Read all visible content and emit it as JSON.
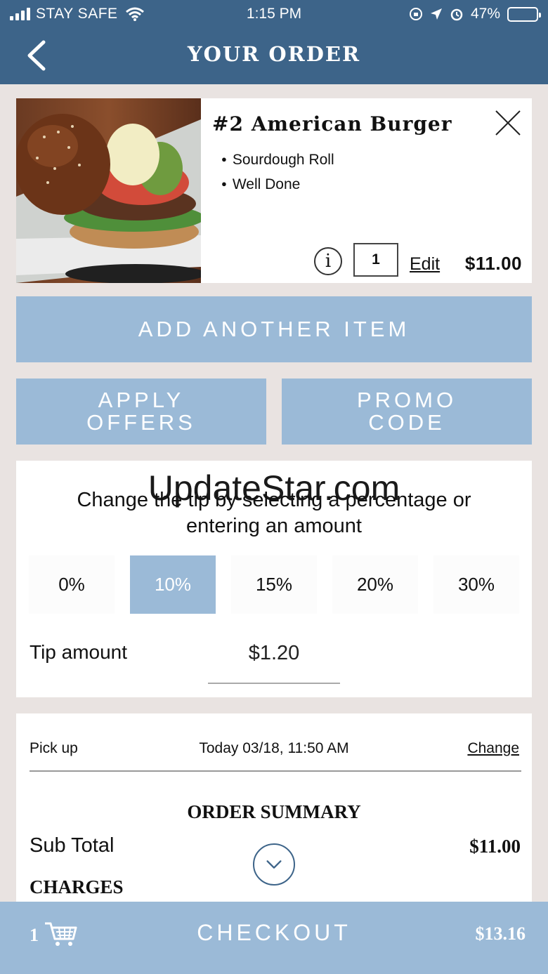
{
  "status_bar": {
    "carrier": "STAY SAFE",
    "time": "1:15 PM",
    "battery": "47%",
    "battery_level": 0.47
  },
  "header": {
    "title": "YOUR ORDER",
    "back_icon": "chevron-left-icon",
    "color": "#3d6489"
  },
  "item": {
    "name": "#2 American Burger",
    "modifiers": [
      "Sourdough Roll",
      "Well Done"
    ],
    "quantity": "1",
    "edit_label": "Edit",
    "price": "$11.00",
    "info_icon": "info-icon",
    "close_icon": "close-icon"
  },
  "buttons": {
    "add_item": "ADD ANOTHER ITEM",
    "apply_offers": [
      "APPLY",
      "OFFERS"
    ],
    "promo_code": [
      "PROMO",
      "CODE"
    ],
    "color": "#9bbad7"
  },
  "watermark": "UpdateStar.com",
  "tip": {
    "instructions": [
      "Change the tip by selecting a percentage or",
      "entering an amount"
    ],
    "options": [
      "0%",
      "10%",
      "15%",
      "20%",
      "30%"
    ],
    "selected": "10%",
    "amount_label": "Tip amount",
    "amount_value": "$1.20"
  },
  "summary": {
    "pickup_label": "Pick up",
    "pickup_time": "Today 03/18, 11:50 AM",
    "change_label": "Change",
    "title": "ORDER SUMMARY",
    "subtotal_label": "Sub Total",
    "subtotal_value": "$11.00",
    "charges_label": "CHARGES"
  },
  "checkout": {
    "cart_count": "1",
    "label": "CHECKOUT",
    "total": "$13.16"
  }
}
